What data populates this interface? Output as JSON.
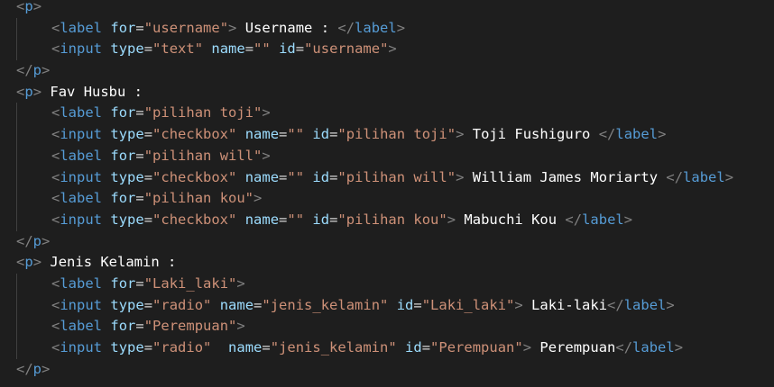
{
  "code": {
    "lines": [
      {
        "indent": false,
        "tokens": [
          {
            "k": "t",
            "s": "<"
          },
          {
            "k": "n",
            "s": "p"
          },
          {
            "k": "t",
            "s": ">"
          }
        ]
      },
      {
        "indent": true,
        "tokens": [
          {
            "k": "t",
            "s": "<"
          },
          {
            "k": "n",
            "s": "label"
          },
          {
            "k": "x",
            "s": " "
          },
          {
            "k": "a",
            "s": "for"
          },
          {
            "k": "eq",
            "s": "="
          },
          {
            "k": "v",
            "s": "\"username\""
          },
          {
            "k": "t",
            "s": ">"
          },
          {
            "k": "x",
            "s": " Username : "
          },
          {
            "k": "t",
            "s": "</"
          },
          {
            "k": "n",
            "s": "label"
          },
          {
            "k": "t",
            "s": ">"
          }
        ]
      },
      {
        "indent": true,
        "tokens": [
          {
            "k": "t",
            "s": "<"
          },
          {
            "k": "n",
            "s": "input"
          },
          {
            "k": "x",
            "s": " "
          },
          {
            "k": "a",
            "s": "type"
          },
          {
            "k": "eq",
            "s": "="
          },
          {
            "k": "v",
            "s": "\"text\""
          },
          {
            "k": "x",
            "s": " "
          },
          {
            "k": "a",
            "s": "name"
          },
          {
            "k": "eq",
            "s": "="
          },
          {
            "k": "v",
            "s": "\"\""
          },
          {
            "k": "x",
            "s": " "
          },
          {
            "k": "a",
            "s": "id"
          },
          {
            "k": "eq",
            "s": "="
          },
          {
            "k": "v",
            "s": "\"username\""
          },
          {
            "k": "t",
            "s": ">"
          }
        ]
      },
      {
        "indent": false,
        "tokens": [
          {
            "k": "t",
            "s": "</"
          },
          {
            "k": "n",
            "s": "p"
          },
          {
            "k": "t",
            "s": ">"
          }
        ]
      },
      {
        "indent": false,
        "tokens": [
          {
            "k": "t",
            "s": "<"
          },
          {
            "k": "n",
            "s": "p"
          },
          {
            "k": "t",
            "s": ">"
          },
          {
            "k": "x",
            "s": " Fav Husbu :"
          }
        ]
      },
      {
        "indent": true,
        "tokens": [
          {
            "k": "t",
            "s": "<"
          },
          {
            "k": "n",
            "s": "label"
          },
          {
            "k": "x",
            "s": " "
          },
          {
            "k": "a",
            "s": "for"
          },
          {
            "k": "eq",
            "s": "="
          },
          {
            "k": "v",
            "s": "\"pilihan toji\""
          },
          {
            "k": "t",
            "s": ">"
          }
        ]
      },
      {
        "indent": true,
        "tokens": [
          {
            "k": "t",
            "s": "<"
          },
          {
            "k": "n",
            "s": "input"
          },
          {
            "k": "x",
            "s": " "
          },
          {
            "k": "a",
            "s": "type"
          },
          {
            "k": "eq",
            "s": "="
          },
          {
            "k": "v",
            "s": "\"checkbox\""
          },
          {
            "k": "x",
            "s": " "
          },
          {
            "k": "a",
            "s": "name"
          },
          {
            "k": "eq",
            "s": "="
          },
          {
            "k": "v",
            "s": "\"\""
          },
          {
            "k": "x",
            "s": " "
          },
          {
            "k": "a",
            "s": "id"
          },
          {
            "k": "eq",
            "s": "="
          },
          {
            "k": "v",
            "s": "\"pilihan toji\""
          },
          {
            "k": "t",
            "s": ">"
          },
          {
            "k": "x",
            "s": " Toji Fushiguro "
          },
          {
            "k": "t",
            "s": "</"
          },
          {
            "k": "n",
            "s": "label"
          },
          {
            "k": "t",
            "s": ">"
          }
        ]
      },
      {
        "indent": true,
        "tokens": [
          {
            "k": "t",
            "s": "<"
          },
          {
            "k": "n",
            "s": "label"
          },
          {
            "k": "x",
            "s": " "
          },
          {
            "k": "a",
            "s": "for"
          },
          {
            "k": "eq",
            "s": "="
          },
          {
            "k": "v",
            "s": "\"pilihan will\""
          },
          {
            "k": "t",
            "s": ">"
          }
        ]
      },
      {
        "indent": true,
        "tokens": [
          {
            "k": "t",
            "s": "<"
          },
          {
            "k": "n",
            "s": "input"
          },
          {
            "k": "x",
            "s": " "
          },
          {
            "k": "a",
            "s": "type"
          },
          {
            "k": "eq",
            "s": "="
          },
          {
            "k": "v",
            "s": "\"checkbox\""
          },
          {
            "k": "x",
            "s": " "
          },
          {
            "k": "a",
            "s": "name"
          },
          {
            "k": "eq",
            "s": "="
          },
          {
            "k": "v",
            "s": "\"\""
          },
          {
            "k": "x",
            "s": " "
          },
          {
            "k": "a",
            "s": "id"
          },
          {
            "k": "eq",
            "s": "="
          },
          {
            "k": "v",
            "s": "\"pilihan will\""
          },
          {
            "k": "t",
            "s": ">"
          },
          {
            "k": "x",
            "s": " William James Moriarty "
          },
          {
            "k": "t",
            "s": "</"
          },
          {
            "k": "n",
            "s": "label"
          },
          {
            "k": "t",
            "s": ">"
          }
        ]
      },
      {
        "indent": true,
        "tokens": [
          {
            "k": "t",
            "s": "<"
          },
          {
            "k": "n",
            "s": "label"
          },
          {
            "k": "x",
            "s": " "
          },
          {
            "k": "a",
            "s": "for"
          },
          {
            "k": "eq",
            "s": "="
          },
          {
            "k": "v",
            "s": "\"pilihan kou\""
          },
          {
            "k": "t",
            "s": ">"
          }
        ]
      },
      {
        "indent": true,
        "tokens": [
          {
            "k": "t",
            "s": "<"
          },
          {
            "k": "n",
            "s": "input"
          },
          {
            "k": "x",
            "s": " "
          },
          {
            "k": "a",
            "s": "type"
          },
          {
            "k": "eq",
            "s": "="
          },
          {
            "k": "v",
            "s": "\"checkbox\""
          },
          {
            "k": "x",
            "s": " "
          },
          {
            "k": "a",
            "s": "name"
          },
          {
            "k": "eq",
            "s": "="
          },
          {
            "k": "v",
            "s": "\"\""
          },
          {
            "k": "x",
            "s": " "
          },
          {
            "k": "a",
            "s": "id"
          },
          {
            "k": "eq",
            "s": "="
          },
          {
            "k": "v",
            "s": "\"pilihan kou\""
          },
          {
            "k": "t",
            "s": ">"
          },
          {
            "k": "x",
            "s": " Mabuchi Kou "
          },
          {
            "k": "t",
            "s": "</"
          },
          {
            "k": "n",
            "s": "label"
          },
          {
            "k": "t",
            "s": ">"
          }
        ]
      },
      {
        "indent": false,
        "tokens": [
          {
            "k": "t",
            "s": "</"
          },
          {
            "k": "n",
            "s": "p"
          },
          {
            "k": "t",
            "s": ">"
          }
        ]
      },
      {
        "indent": false,
        "tokens": [
          {
            "k": "t",
            "s": "<"
          },
          {
            "k": "n",
            "s": "p"
          },
          {
            "k": "t",
            "s": ">"
          },
          {
            "k": "x",
            "s": " Jenis Kelamin :"
          }
        ]
      },
      {
        "indent": true,
        "tokens": [
          {
            "k": "t",
            "s": "<"
          },
          {
            "k": "n",
            "s": "label"
          },
          {
            "k": "x",
            "s": " "
          },
          {
            "k": "a",
            "s": "for"
          },
          {
            "k": "eq",
            "s": "="
          },
          {
            "k": "v",
            "s": "\"Laki_laki\""
          },
          {
            "k": "t",
            "s": ">"
          }
        ]
      },
      {
        "indent": true,
        "tokens": [
          {
            "k": "t",
            "s": "<"
          },
          {
            "k": "n",
            "s": "input"
          },
          {
            "k": "x",
            "s": " "
          },
          {
            "k": "a",
            "s": "type"
          },
          {
            "k": "eq",
            "s": "="
          },
          {
            "k": "v",
            "s": "\"radio\""
          },
          {
            "k": "x",
            "s": " "
          },
          {
            "k": "a",
            "s": "name"
          },
          {
            "k": "eq",
            "s": "="
          },
          {
            "k": "v",
            "s": "\"jenis_kelamin\""
          },
          {
            "k": "x",
            "s": " "
          },
          {
            "k": "a",
            "s": "id"
          },
          {
            "k": "eq",
            "s": "="
          },
          {
            "k": "v",
            "s": "\"Laki_laki\""
          },
          {
            "k": "t",
            "s": ">"
          },
          {
            "k": "x",
            "s": " Laki-laki"
          },
          {
            "k": "t",
            "s": "</"
          },
          {
            "k": "n",
            "s": "label"
          },
          {
            "k": "t",
            "s": ">"
          }
        ]
      },
      {
        "indent": true,
        "tokens": [
          {
            "k": "t",
            "s": "<"
          },
          {
            "k": "n",
            "s": "label"
          },
          {
            "k": "x",
            "s": " "
          },
          {
            "k": "a",
            "s": "for"
          },
          {
            "k": "eq",
            "s": "="
          },
          {
            "k": "v",
            "s": "\"Perempuan\""
          },
          {
            "k": "t",
            "s": ">"
          }
        ]
      },
      {
        "indent": true,
        "tokens": [
          {
            "k": "t",
            "s": "<"
          },
          {
            "k": "n",
            "s": "input"
          },
          {
            "k": "x",
            "s": " "
          },
          {
            "k": "a",
            "s": "type"
          },
          {
            "k": "eq",
            "s": "="
          },
          {
            "k": "v",
            "s": "\"radio\""
          },
          {
            "k": "x",
            "s": "  "
          },
          {
            "k": "a",
            "s": "name"
          },
          {
            "k": "eq",
            "s": "="
          },
          {
            "k": "v",
            "s": "\"jenis_kelamin\""
          },
          {
            "k": "x",
            "s": " "
          },
          {
            "k": "a",
            "s": "id"
          },
          {
            "k": "eq",
            "s": "="
          },
          {
            "k": "v",
            "s": "\"Perempuan\""
          },
          {
            "k": "t",
            "s": ">"
          },
          {
            "k": "x",
            "s": " Perempuan"
          },
          {
            "k": "t",
            "s": "</"
          },
          {
            "k": "n",
            "s": "label"
          },
          {
            "k": "t",
            "s": ">"
          }
        ]
      },
      {
        "indent": false,
        "tokens": [
          {
            "k": "t",
            "s": "</"
          },
          {
            "k": "n",
            "s": "p"
          },
          {
            "k": "t",
            "s": ">"
          }
        ]
      }
    ]
  }
}
